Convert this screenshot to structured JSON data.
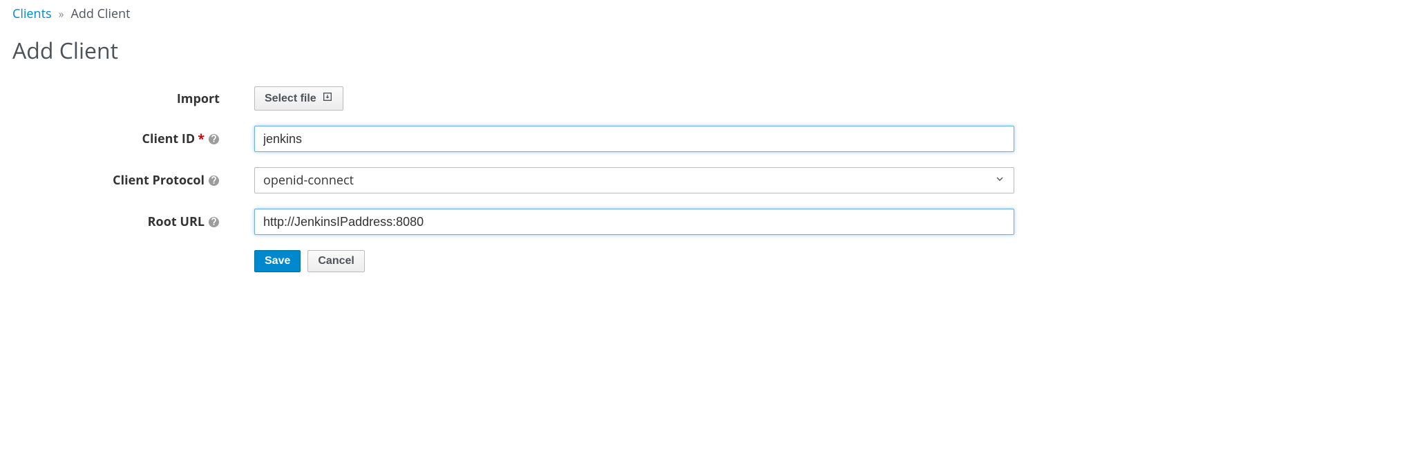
{
  "breadcrumb": {
    "parent": "Clients",
    "current": "Add Client"
  },
  "title": "Add Client",
  "form": {
    "import_label": "Import",
    "import_button": "Select file",
    "client_id": {
      "label": "Client ID",
      "value": "jenkins"
    },
    "client_protocol": {
      "label": "Client Protocol",
      "value": "openid-connect"
    },
    "root_url": {
      "label": "Root URL",
      "value": "http://JenkinsIPaddress:8080"
    }
  },
  "buttons": {
    "save": "Save",
    "cancel": "Cancel"
  }
}
